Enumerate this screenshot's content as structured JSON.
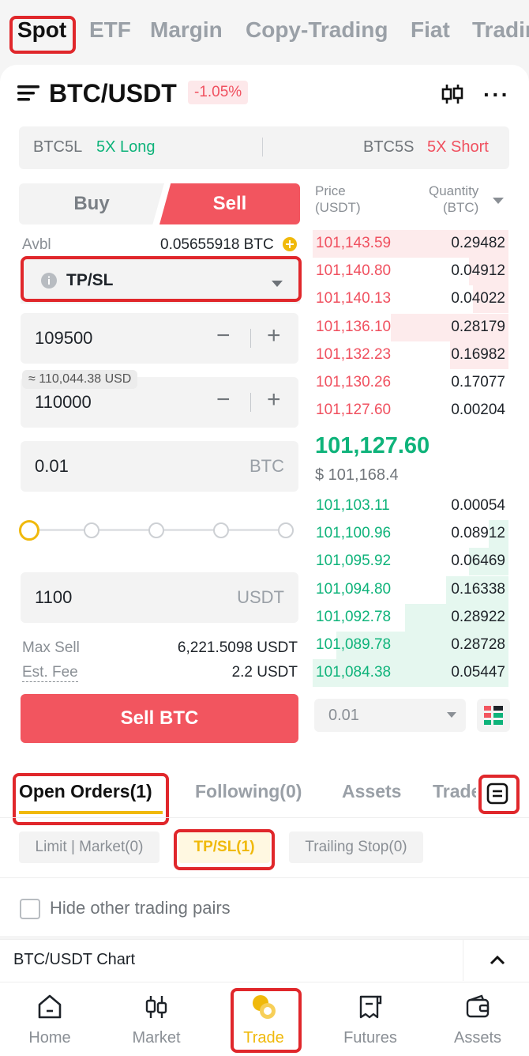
{
  "top_tabs": [
    "Spot",
    "ETF",
    "Margin",
    "Copy-Trading",
    "Fiat",
    "Trading"
  ],
  "pair": {
    "symbol": "BTC/USDT",
    "change": "-1.05%"
  },
  "leverage": {
    "long_symbol": "BTC5L",
    "long_label": "5X Long",
    "short_symbol": "BTC5S",
    "short_label": "5X Short"
  },
  "form": {
    "buy_tab": "Buy",
    "sell_tab": "Sell",
    "avbl_label": "Avbl",
    "avbl_value": "0.05655918 BTC",
    "order_type": "TP/SL",
    "trigger_price": "109500",
    "approx_usd": "≈ 110,044.38 USD",
    "limit_price": "110000",
    "amount": "0.01",
    "amount_unit": "BTC",
    "total": "1100",
    "total_unit": "USDT",
    "max_sell_label": "Max Sell",
    "max_sell_value": "6,221.5098 USDT",
    "fee_label": "Est. Fee",
    "fee_value": "2.2 USDT",
    "submit_label": "Sell BTC"
  },
  "orderbook": {
    "price_header": "Price\n(USDT)",
    "qty_header": "Quantity\n(BTC)",
    "asks": [
      {
        "price": "101,143.59",
        "qty": "0.29482",
        "depth": 1.0
      },
      {
        "price": "101,140.80",
        "qty": "0.04912",
        "depth": 0.2
      },
      {
        "price": "101,140.13",
        "qty": "0.04022",
        "depth": 0.18
      },
      {
        "price": "101,136.10",
        "qty": "0.28179",
        "depth": 0.6
      },
      {
        "price": "101,132.23",
        "qty": "0.16982",
        "depth": 0.3
      },
      {
        "price": "101,130.26",
        "qty": "0.17077",
        "depth": 0
      },
      {
        "price": "101,127.60",
        "qty": "0.00204",
        "depth": 0
      }
    ],
    "last_price": "101,127.60",
    "last_usd": "$ 101,168.4",
    "bids": [
      {
        "price": "101,103.11",
        "qty": "0.00054",
        "depth": 0
      },
      {
        "price": "101,100.96",
        "qty": "0.08912",
        "depth": 0.1
      },
      {
        "price": "101,095.92",
        "qty": "0.06469",
        "depth": 0.2
      },
      {
        "price": "101,094.80",
        "qty": "0.16338",
        "depth": 0.32
      },
      {
        "price": "101,092.78",
        "qty": "0.28922",
        "depth": 0.53
      },
      {
        "price": "101,089.78",
        "qty": "0.28728",
        "depth": 0.88
      },
      {
        "price": "101,084.38",
        "qty": "0.05447",
        "depth": 1.0
      }
    ],
    "precision": "0.01"
  },
  "orders": {
    "tabs": [
      "Open Orders(1)",
      "Following(0)",
      "Assets",
      "Trades"
    ],
    "sub_tabs": [
      "Limit | Market(0)",
      "TP/SL(1)",
      "Trailing Stop(0)"
    ],
    "hide_pairs_label": "Hide other trading pairs",
    "chart_label": "BTC/USDT Chart"
  },
  "nav": [
    "Home",
    "Market",
    "Trade",
    "Futures",
    "Assets"
  ],
  "colors": {
    "sell": "#f2555f",
    "buy": "#0eb37a",
    "accent": "#f0b90b",
    "highlight": "#e0272b"
  }
}
